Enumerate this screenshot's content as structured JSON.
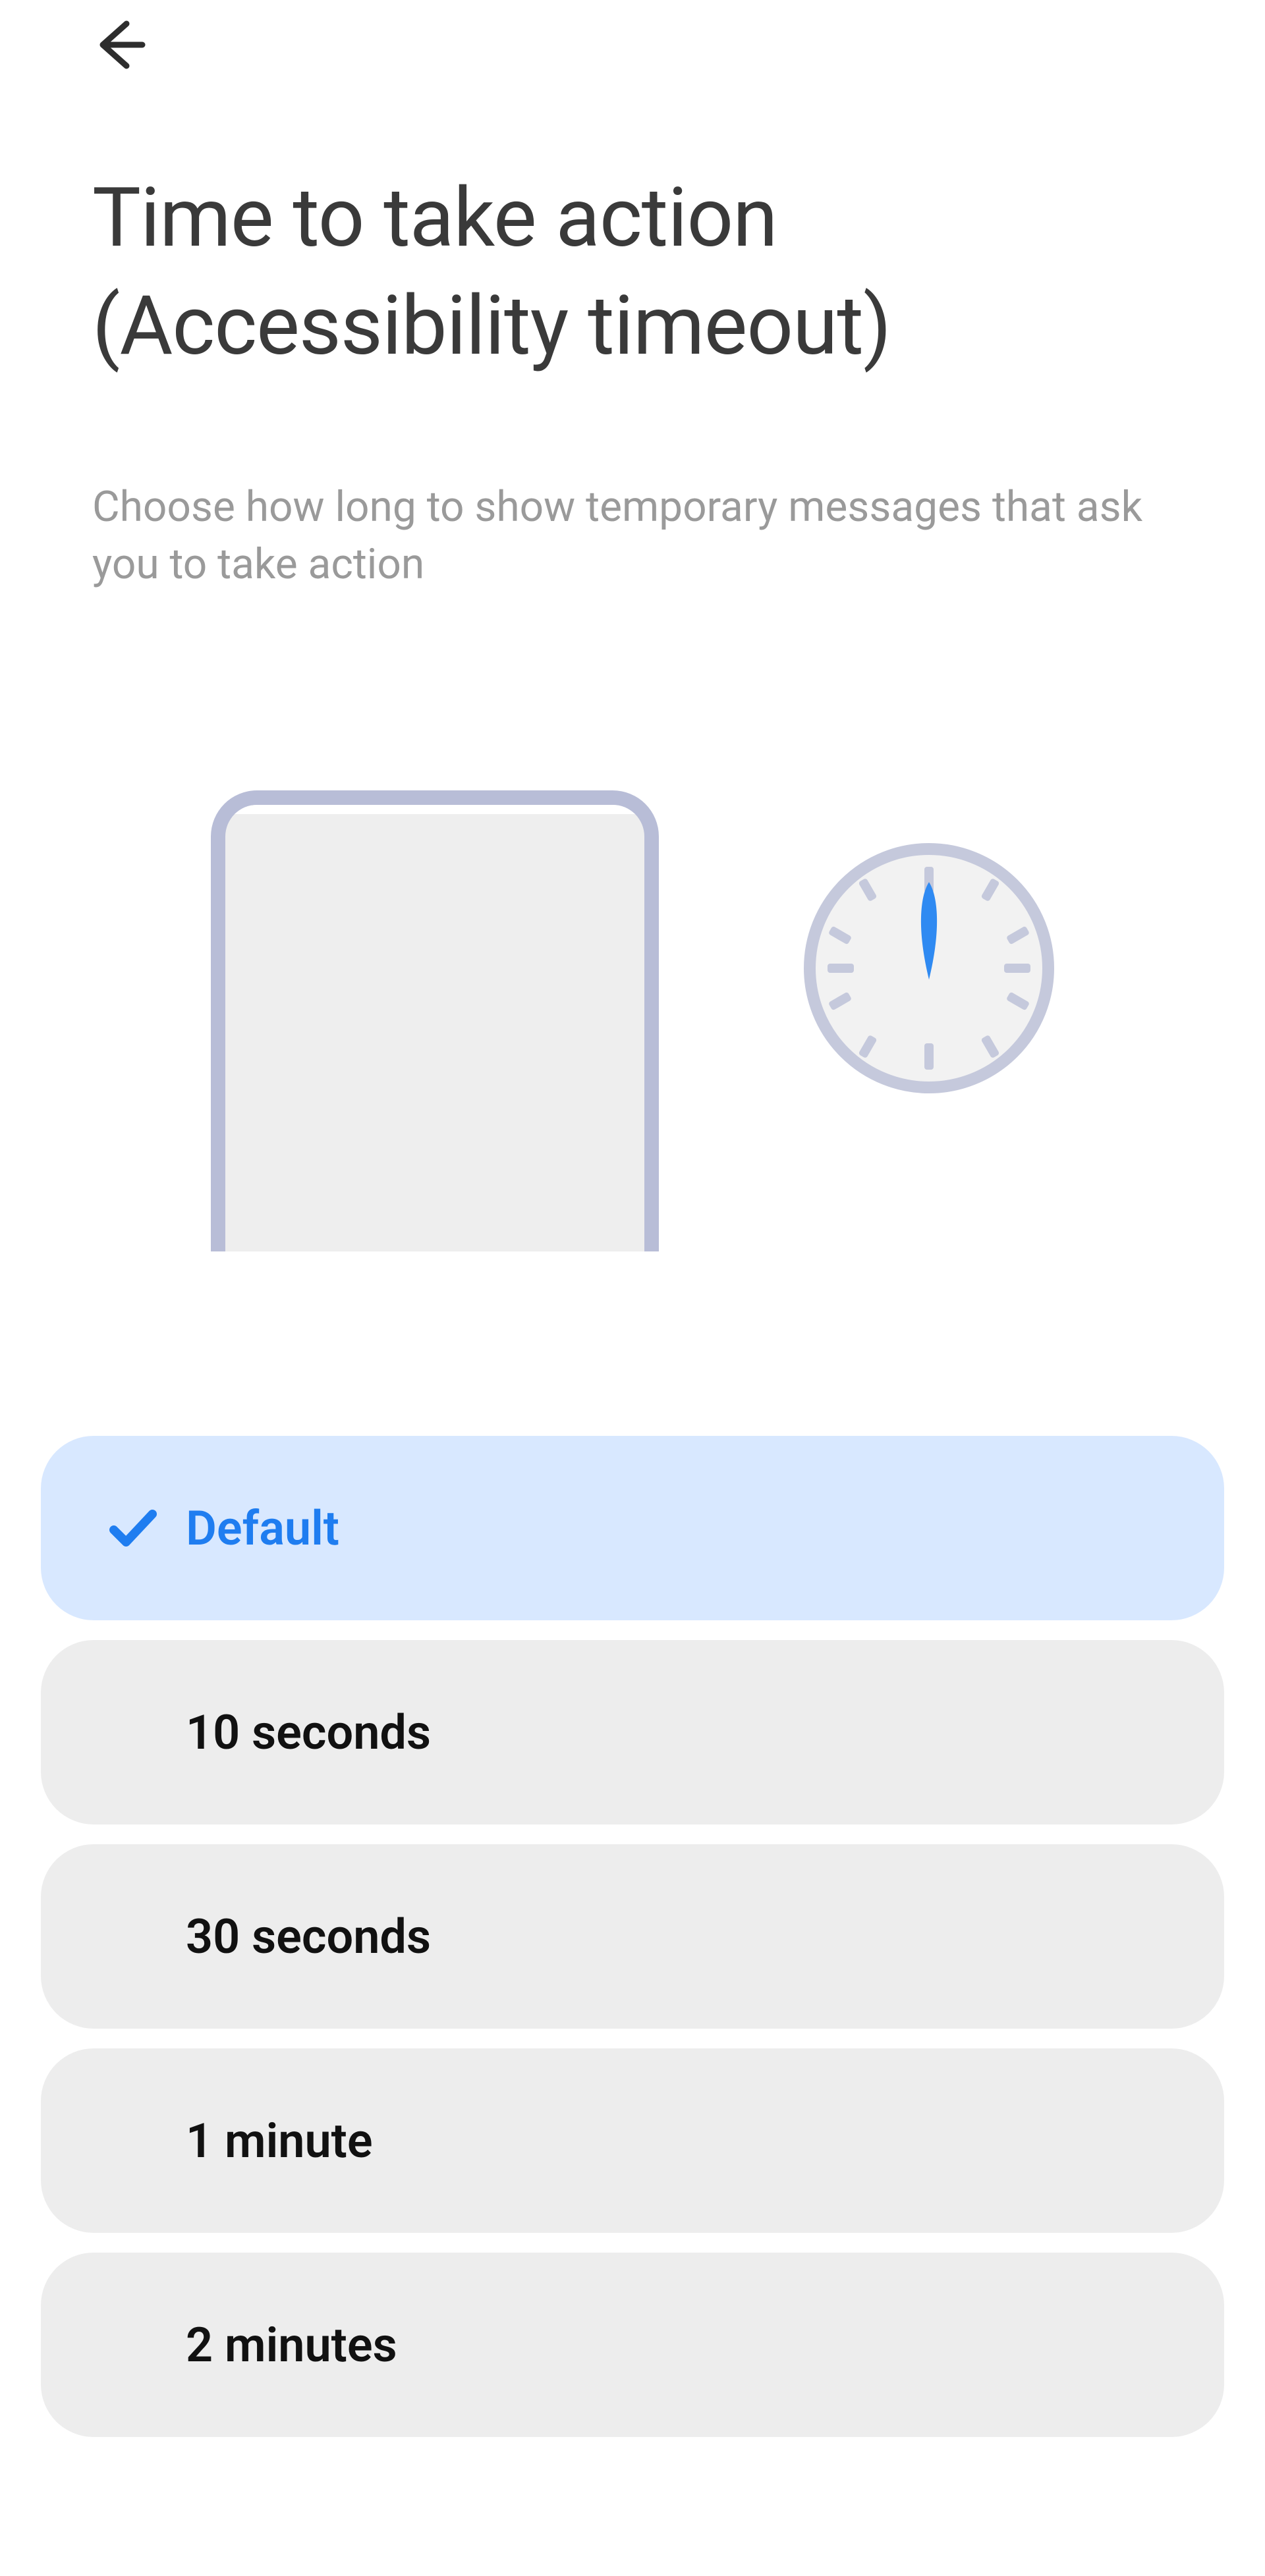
{
  "header": {
    "title": "Time to take action (Accessibility timeout)",
    "subtitle": "Choose how long to show temporary messages that ask you to take action"
  },
  "illustration": {
    "phone_icon": "phone-outline",
    "clock_icon": "timer-clock"
  },
  "options": [
    {
      "label": "Default",
      "selected": true
    },
    {
      "label": "10 seconds",
      "selected": false
    },
    {
      "label": "30 seconds",
      "selected": false
    },
    {
      "label": "1 minute",
      "selected": false
    },
    {
      "label": "2 minutes",
      "selected": false
    }
  ],
  "colors": {
    "accent": "#1f7df0",
    "option_bg": "#ededed",
    "selected_bg": "#d8e8ff",
    "text_muted": "#9a9a9a"
  }
}
